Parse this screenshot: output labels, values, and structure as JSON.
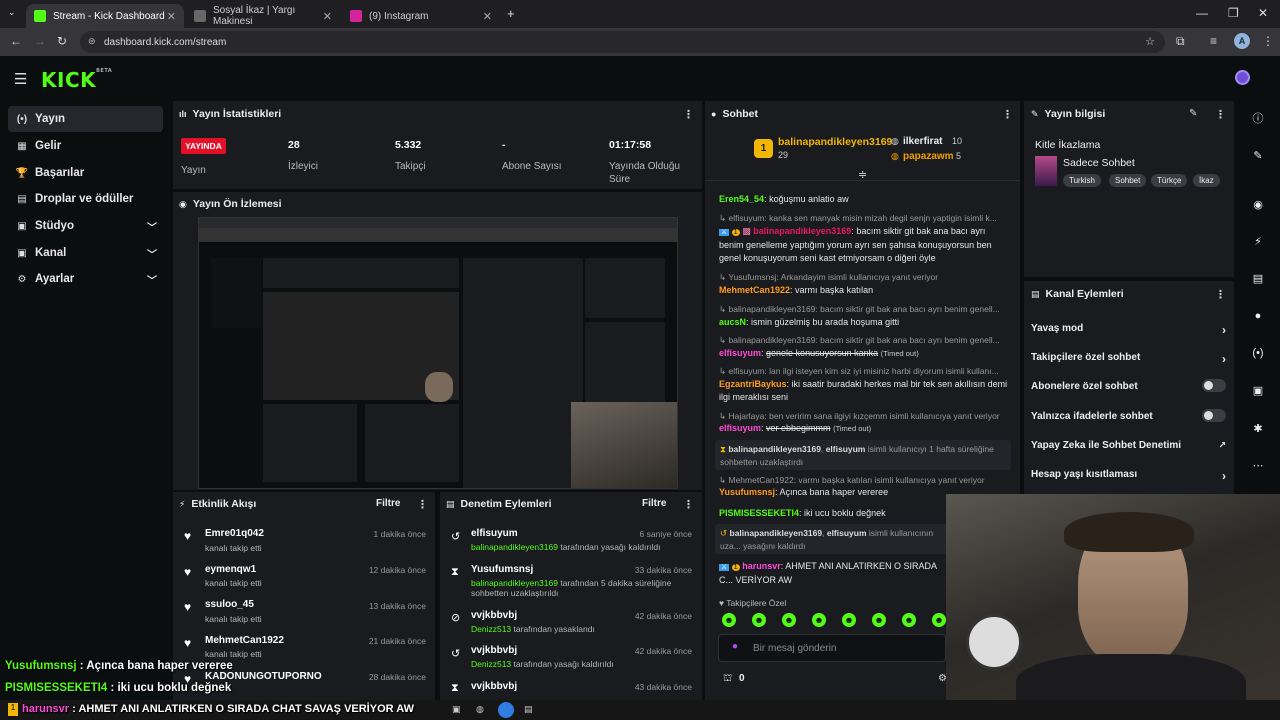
{
  "browser": {
    "tabs": [
      {
        "label": "Stream - Kick Dashboard",
        "active": true
      },
      {
        "label": "Sosyal İkaz | Yargı Makinesi",
        "active": false
      },
      {
        "label": "(9) Instagram",
        "active": false
      }
    ],
    "new_tab": "+",
    "url": "dashboard.kick.com/stream",
    "profile_initial": "A"
  },
  "brand": {
    "logo": "KICK",
    "logo_sup": "BETA",
    "accent": "#53fc18"
  },
  "sidebar": {
    "items": [
      {
        "label": "Yayın",
        "icon": "broadcast-icon",
        "glyph": "(•)",
        "active": true,
        "expandable": false
      },
      {
        "label": "Gelir",
        "icon": "money-icon",
        "glyph": "▦",
        "active": false,
        "expandable": false
      },
      {
        "label": "Başarılar",
        "icon": "trophy-icon",
        "glyph": "🏆",
        "active": false,
        "expandable": false
      },
      {
        "label": "Droplar ve ödüller",
        "icon": "gift-icon",
        "glyph": "▤",
        "active": false,
        "expandable": false
      },
      {
        "label": "Stüdyo",
        "icon": "studio-icon",
        "glyph": "▣",
        "active": false,
        "expandable": true
      },
      {
        "label": "Kanal",
        "icon": "channel-icon",
        "glyph": "▣",
        "active": false,
        "expandable": true
      },
      {
        "label": "Ayarlar",
        "icon": "gear-icon",
        "glyph": "⚙",
        "active": false,
        "expandable": true
      }
    ]
  },
  "stats": {
    "title": "Yayın İstatistikleri",
    "live_badge": "YAYINDA",
    "live_label": "Yayın",
    "viewers": {
      "value": "28",
      "label": "İzleyici"
    },
    "followers": {
      "value": "5.332",
      "label": "Takipçi"
    },
    "subs": {
      "value": "-",
      "label": "Abone Sayısı"
    },
    "uptime": {
      "value": "01:17:58",
      "label": "Yayında Olduğu Süre"
    }
  },
  "preview": {
    "title": "Yayın Ön İzlemesi"
  },
  "activity": {
    "title": "Etkinlik Akışı",
    "filter": "Filtre",
    "rows": [
      {
        "user": "Emre01q042",
        "action": "kanalı takip etti",
        "time": "1 dakika önce"
      },
      {
        "user": "eymenqw1",
        "action": "kanalı takip etti",
        "time": "12 dakika önce"
      },
      {
        "user": "ssuloo_45",
        "action": "kanalı takip etti",
        "time": "13 dakika önce"
      },
      {
        "user": "MehmetCan1922",
        "action": "kanalı takip etti",
        "time": "21 dakika önce"
      },
      {
        "user": "KADONUNGOTUPORNO",
        "action": "",
        "time": "28 dakika önce"
      }
    ]
  },
  "moderation": {
    "title": "Denetim Eylemleri",
    "filter": "Filtre",
    "rows": [
      {
        "user": "elfisuyum",
        "glyph": "↺",
        "mod": "balinapandikleyen3169",
        "text": " tarafından yasağı kaldırıldı",
        "text2": "",
        "time": "6 saniye önce"
      },
      {
        "user": "Yusufumsnsj",
        "glyph": "⧗",
        "mod": "balinapandikleyen3169",
        "text": " tarafından 5 dakika süreliğine",
        "text2": "sohbetten uzaklaştırıldı",
        "time": "33 dakika önce"
      },
      {
        "user": "vvjkbbvbj",
        "glyph": "⊘",
        "mod": "Denizz513",
        "text": " tarafından yasaklandı",
        "text2": "",
        "time": "42 dakika önce"
      },
      {
        "user": "vvjkbbvbj",
        "glyph": "↺",
        "mod": "Denizz513",
        "text": " tarafından yasağı kaldırıldı",
        "text2": "",
        "time": "42 dakika önce"
      },
      {
        "user": "vvjkbbvbj",
        "glyph": "⧗",
        "mod": "",
        "text": "",
        "text2": "",
        "time": "43 dakika önce"
      }
    ]
  },
  "chat": {
    "title": "Sohbet",
    "top_rank": "1",
    "top_user": "balinapandikleyen3169",
    "top_count": "29",
    "second_user": "ilkerfirat",
    "second_count": "10",
    "third_user": "papazawm",
    "third_count": "5",
    "messages": [
      {
        "kind": "msg",
        "user": "Eren54_54",
        "color": "green",
        "text": "koğuşmu anlatio aw"
      },
      {
        "kind": "reply",
        "text": "elfisuyum: kanka sen manyak misin mizah degil senjn yaptigin isimli k..."
      },
      {
        "kind": "msg",
        "user": "balinapandikleyen3169",
        "color": "red",
        "text": "bacım siktir git bak ana bacı ayrı benim genelleme yaptığım yorum ayrı sen şahısa konuşuyorsun ben genel konuşuyorum seni kast etmiyorsam o diğeri öyle"
      },
      {
        "kind": "reply",
        "text": "Yusufumsnsj: Arkandayim isimli kullanıcıya yanıt veriyor"
      },
      {
        "kind": "msg",
        "user": "MehmetCan1922",
        "color": "orange",
        "text": "varmı başka katılan"
      },
      {
        "kind": "reply",
        "text": "balinapandikleyen3169: bacım siktir git bak ana bacı ayrı benim genell..."
      },
      {
        "kind": "msg",
        "user": "aucsN",
        "color": "green",
        "text": "ismin güzelmiş bu arada hoşuma gitti"
      },
      {
        "kind": "reply",
        "text": "balinapandikleyen3169: bacım siktir git bak ana bacı ayrı benim genell..."
      },
      {
        "kind": "timeout",
        "user": "elfisuyum",
        "color": "pink",
        "text": "genele konusuyorsun kanka",
        "note": "(Timed out)"
      },
      {
        "kind": "reply",
        "text": "elfisuyum: lan ilgi isteyen kim siz iyi misiniz harbi diyorum isimli kullanı..."
      },
      {
        "kind": "msg",
        "user": "EgzantriBaykus",
        "color": "orange",
        "text": "iki saatir buradaki herkes mal bir tek sen akıllısın demi ilgi meraklısı seni"
      },
      {
        "kind": "reply",
        "text": "Hajarlaya: ben veririm sana ilgiyi kızçemm isimli kullanıcıya yanıt veriyor"
      },
      {
        "kind": "timeout",
        "user": "elfisuyum",
        "color": "pink",
        "text": "ver ebbegimmm",
        "note": "(Timed out)"
      },
      {
        "kind": "event",
        "mod": "balinapandikleyen3169",
        "target": "elfisuyum",
        "text": " isimli kullanıcıyı 1 hafta süreliğine sohbetten uzaklaştırdı"
      },
      {
        "kind": "reply",
        "text": "MehmetCan1922: varmı başka katılan isimli kullanıcıya yanıt veriyor"
      },
      {
        "kind": "msg",
        "user": "Yusufumsnsj",
        "color": "orange",
        "text": "Açınca bana haper vereree"
      },
      {
        "kind": "msg",
        "user": "PISMISESSEKETI4",
        "color": "green",
        "text": "iki ucu boklu değnek"
      },
      {
        "kind": "event",
        "mod": "balinapandikleyen3169",
        "target": "elfisuyum",
        "text": " isimli kullanıcının uza... yasağını kaldırdı"
      },
      {
        "kind": "msg",
        "user": "harunsvr",
        "color": "pink",
        "text": "AHMET ANI ANLATIRKEN O SIRADA C... VERİYOR AW"
      }
    ],
    "followers_only": "Takipçilere Özel",
    "input_placeholder": "Bir mesaj gönderin",
    "points": "0"
  },
  "stream_info": {
    "title": "Yayın bilgisi",
    "stream_title": "Kitle İkazlama",
    "category": "Sadece Sohbet",
    "tags": [
      "Turkish",
      "Sohbet",
      "Türkçe",
      "İkaz"
    ]
  },
  "channel_actions": {
    "title": "Kanal Eylemleri",
    "items": [
      {
        "label": "Yavaş mod",
        "control": "chevron"
      },
      {
        "label": "Takipçilere özel sohbet",
        "control": "chevron"
      },
      {
        "label": "Abonelere özel sohbet",
        "control": "toggle"
      },
      {
        "label": "Yalnızca ifadelerle sohbet",
        "control": "toggle"
      },
      {
        "label": "Yapay Zeka ile Sohbet Denetimi",
        "control": "external"
      },
      {
        "label": "Hesap yaşı kısıtlaması",
        "control": "chevron"
      }
    ]
  },
  "overlay": {
    "lines": [
      {
        "user": "Yusufumsnsj",
        "text": " : Açınca bana haper vereree"
      },
      {
        "user": "PISMISESSEKETI4",
        "text": " : iki ucu boklu değnek"
      },
      {
        "user": "harunsvr",
        "text": " : AHMET ANI ANLATIRKEN O SIRADA CHAT SAVAŞ VERİYOR AW"
      }
    ]
  }
}
